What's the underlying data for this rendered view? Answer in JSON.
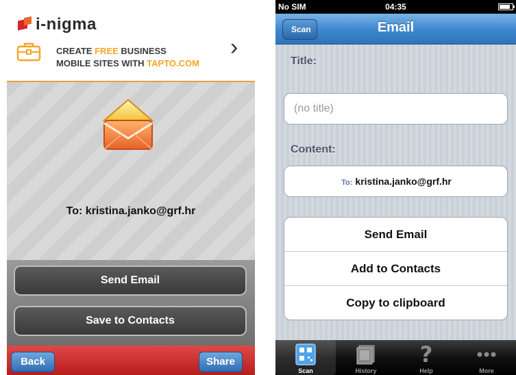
{
  "left": {
    "logo": "i-nigma",
    "banner": {
      "line1_pre": "CREATE ",
      "line1_hl": "FREE",
      "line1_post": " BUSINESS",
      "line2_pre": "MOBILE SITES WITH ",
      "line2_hl": "TAPTO.COM"
    },
    "to_line": "To: kristina.janko@grf.hr",
    "buttons": [
      "Send Email",
      "Save to Contacts"
    ],
    "back_label": "Back",
    "share_label": "Share",
    "colors": {
      "accent": "#f5a623",
      "bar_red": "#c62828",
      "nav_blue": "#3a7bc8"
    }
  },
  "right": {
    "status": {
      "carrier": "No SIM",
      "time": "04:35",
      "battery_level": 0.85
    },
    "nav": {
      "back_label": "Scan",
      "title": "Email"
    },
    "title_label": "Title:",
    "title_placeholder": "(no title)",
    "content_label": "Content:",
    "content_to_label": "To:",
    "content_to_value": "kristina.janko@grf.hr",
    "actions": [
      "Send Email",
      "Add to Contacts",
      "Copy to clipboard"
    ],
    "tabs": [
      {
        "label": "Scan",
        "icon": "qr-scan-icon",
        "active": true
      },
      {
        "label": "History",
        "icon": "history-icon",
        "active": false
      },
      {
        "label": "Help",
        "icon": "help-icon",
        "active": false
      },
      {
        "label": "More",
        "icon": "more-icon",
        "active": false
      }
    ]
  }
}
